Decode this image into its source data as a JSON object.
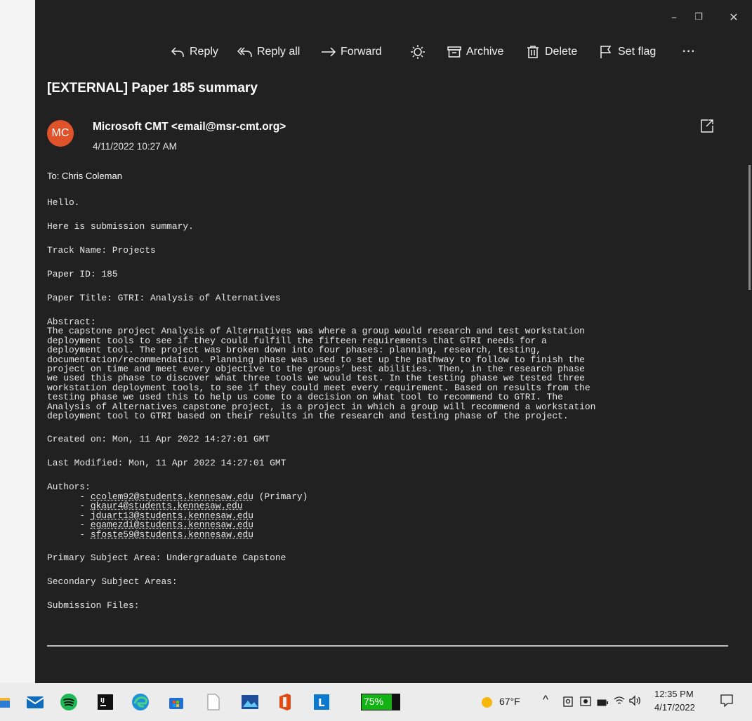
{
  "window": {
    "controls": {
      "minimize": "–",
      "restore": "❐",
      "close": "✕"
    }
  },
  "toolbar": {
    "reply": "Reply",
    "reply_all": "Reply all",
    "forward": "Forward",
    "archive": "Archive",
    "delete": "Delete",
    "set_flag": "Set flag",
    "more": "···"
  },
  "message": {
    "subject": "[EXTERNAL] Paper 185 summary",
    "avatar_initials": "MC",
    "avatar_color": "#e0532a",
    "sender": "Microsoft CMT <email@msr-cmt.org>",
    "date": "4/11/2022 10:27 AM",
    "to": "To: Chris Coleman"
  },
  "body": {
    "greeting": "Hello.",
    "intro": "Here is submission summary.",
    "track": "Track Name: Projects",
    "paper_id": "Paper ID: 185",
    "paper_title": "Paper Title: GTRI: Analysis of Alternatives",
    "abstract_label": "Abstract:",
    "abstract": "The capstone project Analysis of Alternatives was where a group would research and test workstation\ndeployment tools to see if they could fulfill the fifteen requirements that GTRI needs for a\ndeployment tool. The project was broken down into four phases: planning, research, testing,\ndocumentation/recommendation. Planning phase was used to set up the pathway to follow to finish the\nproject on time and meet every objective to the groups’ best abilities. Then, in the research phase\nwe used this phase to discover what three tools we would test. In the testing phase we tested three\nworkstation deployment tools, to see if they could meet every requirement. Based on results from the\ntesting phase we used this to help us come to a decision on what tool to recommend to GTRI. The\nAnalysis of Alternatives capstone project, is a project in which a group will recommend a workstation\ndeployment tool to GTRI based on their results in the research and testing phase of the project.",
    "created": "Created on: Mon, 11 Apr 2022 14:27:01 GMT",
    "modified": "Last Modified: Mon, 11 Apr 2022 14:27:01 GMT",
    "authors_label": "Authors:",
    "authors": [
      {
        "email": "ccolem92@students.kennesaw.edu",
        "note": " (Primary)"
      },
      {
        "email": "gkaur4@students.kennesaw.edu",
        "note": ""
      },
      {
        "email": "jduart13@students.kennesaw.edu",
        "note": ""
      },
      {
        "email": "egamezdi@students.kennesaw.edu",
        "note": ""
      },
      {
        "email": "sfoste59@students.kennesaw.edu",
        "note": ""
      }
    ],
    "primary_area": "Primary Subject Area: Undergraduate Capstone",
    "secondary_areas": "Secondary Subject Areas:",
    "submission_files": "Submission Files:"
  },
  "taskbar": {
    "battery": "75%",
    "weather": "67°F",
    "time": "12:35 PM",
    "date": "4/17/2022"
  }
}
